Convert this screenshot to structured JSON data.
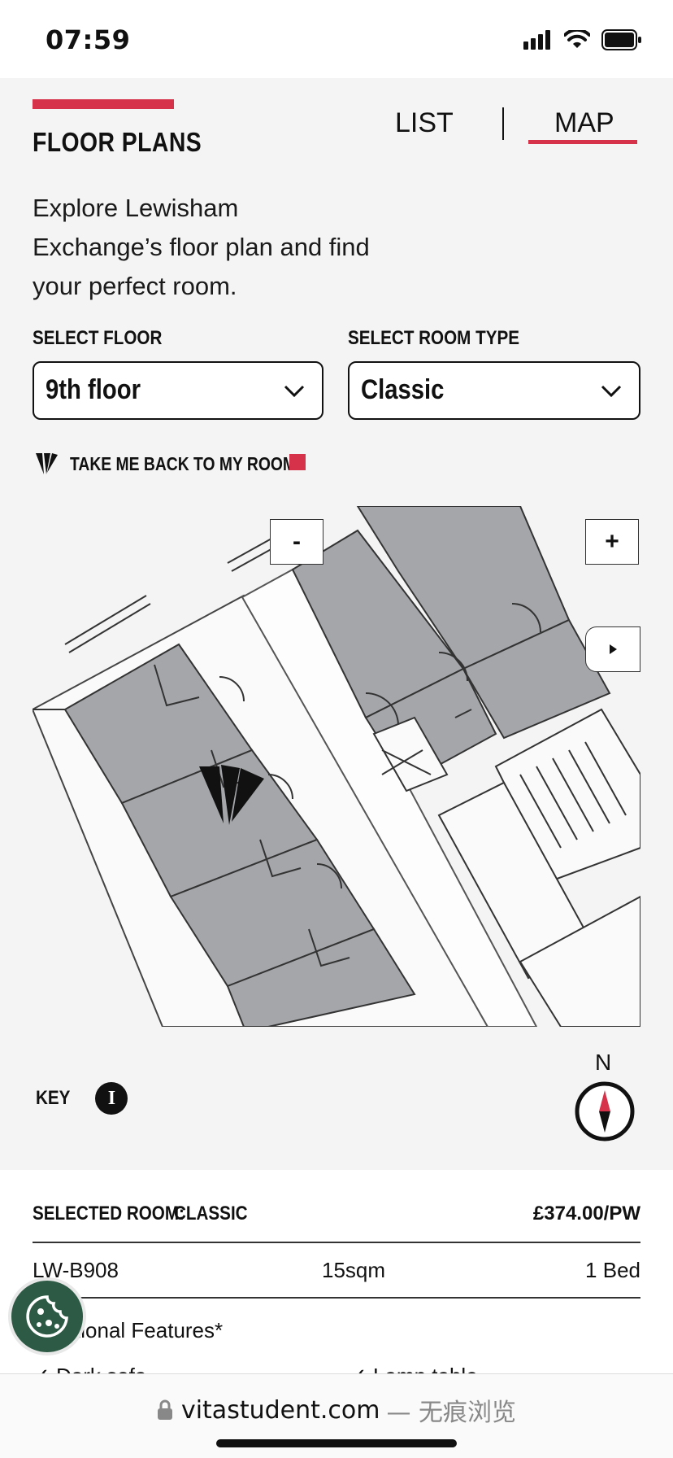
{
  "status_bar": {
    "time": "07:59"
  },
  "header": {
    "title": "FLOOR PLANS"
  },
  "view_tabs": {
    "list": "LIST",
    "map": "MAP",
    "active": "map"
  },
  "intro": "Explore Lewisham Exchange’s floor plan and find your perfect room.",
  "filters": {
    "floor_label": "SELECT FLOOR",
    "floor_value": "9th floor",
    "room_type_label": "SELECT ROOM TYPE",
    "room_type_value": "Classic"
  },
  "back_link": "TAKE ME BACK TO MY ROOM",
  "map": {
    "zoom_out": "-",
    "zoom_in": "+",
    "compass_n": "N"
  },
  "key": {
    "label": "KEY",
    "info_icon": "I"
  },
  "selected_room": {
    "label": "SELECTED ROOM:",
    "type": "CLASSIC",
    "price": "£374.00/PW",
    "id": "LW-B908",
    "size": "15sqm",
    "beds": "1 Bed",
    "features_heading": "Additional Features*",
    "feature_1": "Dark sofa",
    "feature_2": "Lamp table"
  },
  "browser": {
    "domain": "vitastudent.com",
    "suffix": "— 无痕浏览"
  },
  "colors": {
    "accent": "#d6334a",
    "room_fill": "#a4a6aa",
    "cookie_bg": "#2c5a44"
  }
}
